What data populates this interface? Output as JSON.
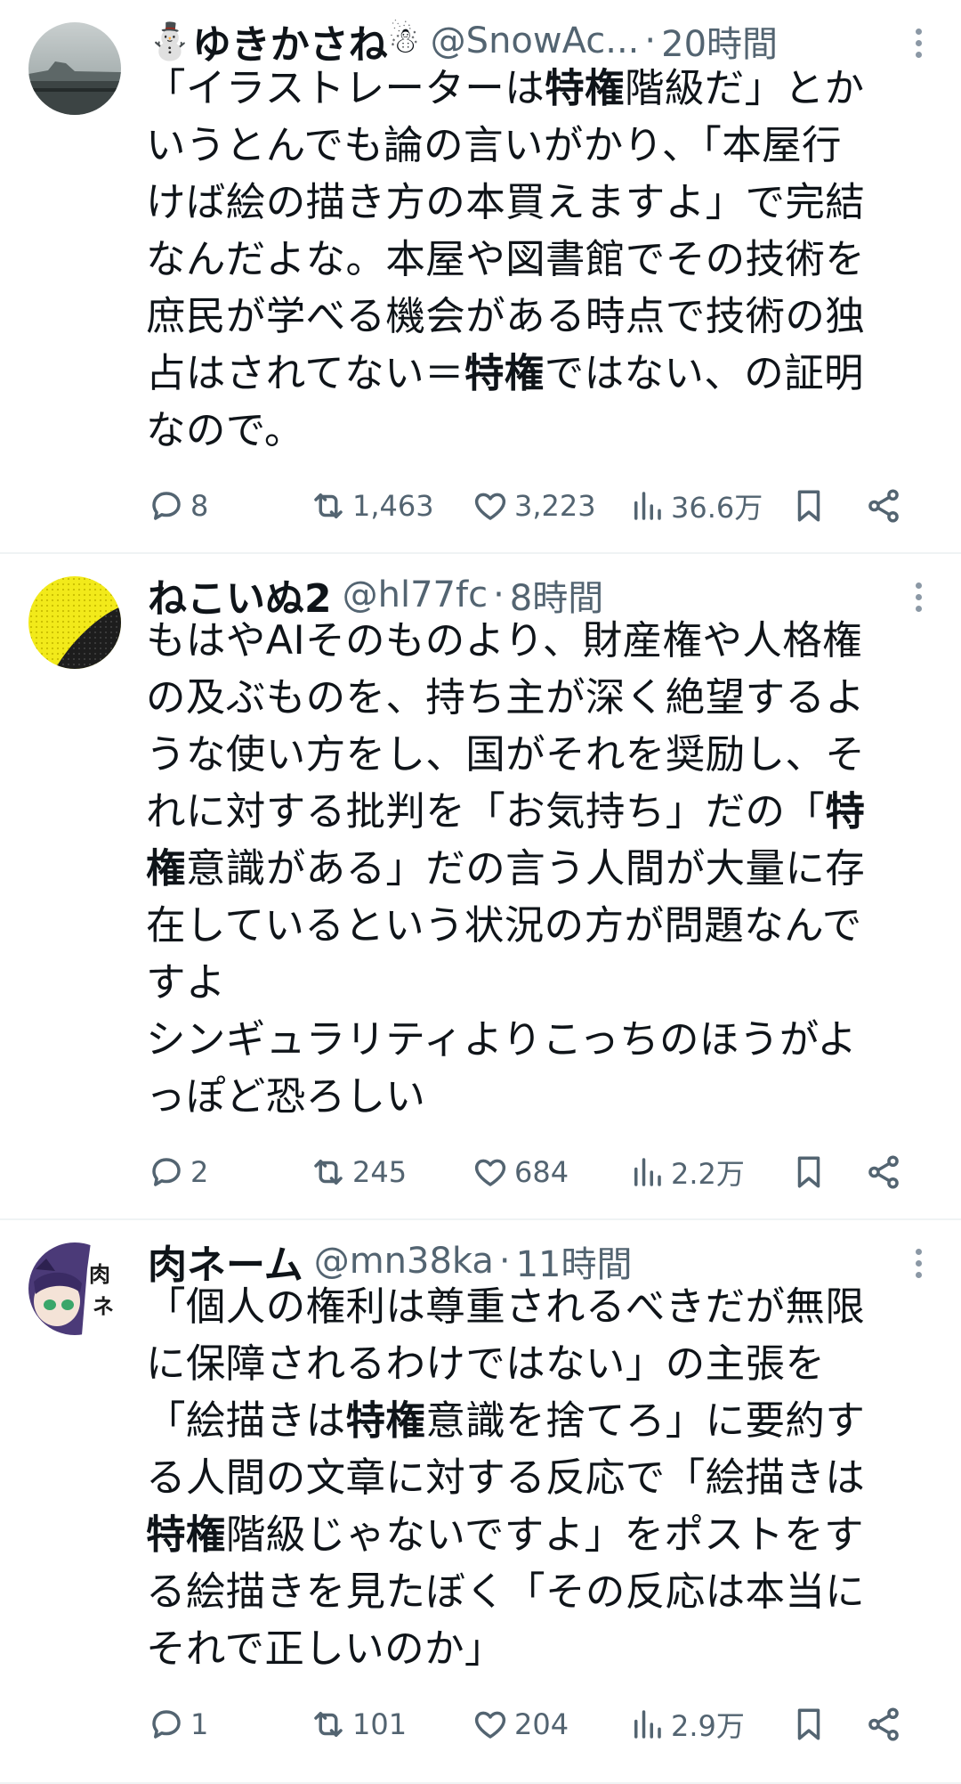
{
  "tweets": [
    {
      "name": "ゆきかさね",
      "name_emoji": "⛄",
      "name_emoji_after": "☃",
      "handle": "@SnowAc...",
      "time": "20時間",
      "lines": [
        [
          "「イラストレーターは",
          "特権",
          "階級だ」とか"
        ],
        [
          "いうとんでも論の言いがかり、「本屋行"
        ],
        [
          "けば絵の描き方の本買えますよ」で完結"
        ],
        [
          "なんだよな。本屋や図書館でその技術を"
        ],
        [
          "庶民が学べる機会がある時点で技術の独"
        ],
        [
          "占はされてない＝",
          "特権",
          "ではない、の証明"
        ],
        [
          "なので。"
        ]
      ],
      "stats": {
        "replies": "8",
        "reposts": "1,463",
        "likes": "3,223",
        "views": "36.6万"
      }
    },
    {
      "name": "ねこいぬ2",
      "handle": "@hl77fc",
      "time": "8時間",
      "lines": [
        [
          "もはやAIそのものより、財産権や人格権"
        ],
        [
          "の及ぶものを、持ち主が深く絶望するよ"
        ],
        [
          "うな使い方をし、国がそれを奨励し、そ"
        ],
        [
          "れに対する批判を「お気持ち」だの「",
          "特",
          ""
        ],
        [
          "",
          "権",
          "意識がある」だの言う人間が大量に存"
        ],
        [
          "在しているという状況の方が問題なんで"
        ],
        [
          "すよ"
        ],
        [
          "シンギュラリティよりこっちのほうがよ"
        ],
        [
          "っぽど恐ろしい"
        ]
      ],
      "stats": {
        "replies": "2",
        "reposts": "245",
        "likes": "684",
        "views": "2.2万"
      }
    },
    {
      "name": "肉ネーム",
      "handle": "@mn38ka",
      "time": "11時間",
      "avatar_text": "肉ネ",
      "lines": [
        [
          "「個人の権利は尊重されるべきだが無限"
        ],
        [
          "に保障されるわけではない」の主張を"
        ],
        [
          "「絵描きは",
          "特権",
          "意識を捨てろ」に要約す"
        ],
        [
          "る人間の文章に対する反応で「絵描きは"
        ],
        [
          "",
          "特権",
          "階級じゃないですよ」をポストをす"
        ],
        [
          "る絵描きを見たぼく「その反応は本当に"
        ],
        [
          "それで正しいのか」"
        ]
      ],
      "stats": {
        "replies": "1",
        "reposts": "101",
        "likes": "204",
        "views": "2.9万"
      }
    }
  ],
  "icons": {
    "reply": "reply-icon",
    "repost": "repost-icon",
    "like": "heart-icon",
    "views": "views-chart-icon",
    "bookmark": "bookmark-icon",
    "share": "share-icon",
    "more": "more-dots-icon"
  },
  "colors": {
    "text": "#0f1419",
    "secondary": "#536471",
    "divider": "#eff3f4"
  }
}
